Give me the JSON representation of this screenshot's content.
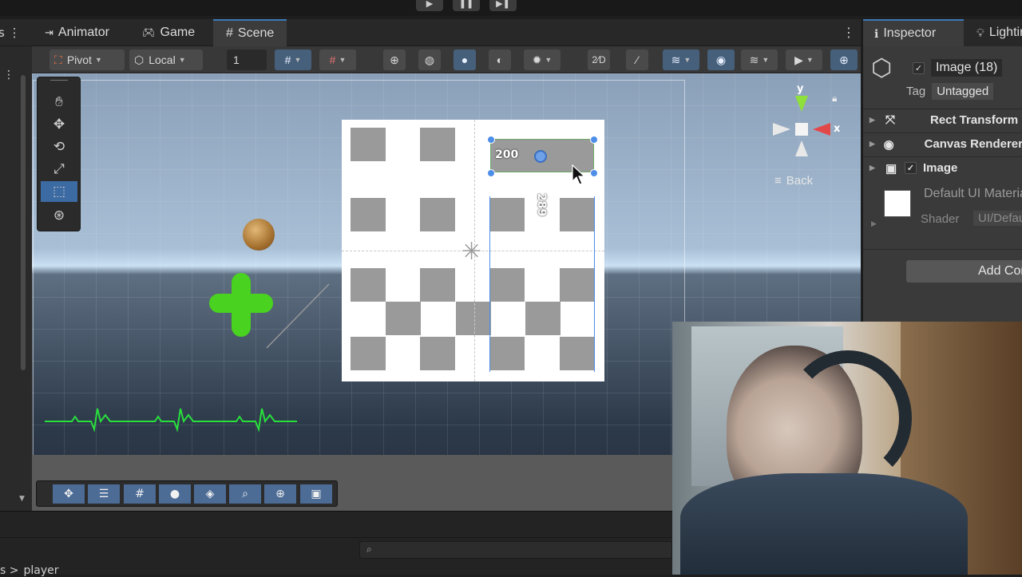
{
  "tabs": [
    {
      "label": "Animator",
      "icon": "animator-icon"
    },
    {
      "label": "Game",
      "icon": "gamepad-icon"
    },
    {
      "label": "Scene",
      "icon": "scene-grid-icon"
    }
  ],
  "toolbar": {
    "pivot_label": "Pivot",
    "space_label": "Local",
    "grid_value": "1"
  },
  "scene": {
    "width_label": "200",
    "height_label": "289",
    "back_label": "Back",
    "axis_y": "y",
    "axis_x": "x"
  },
  "inspector": {
    "tabs": [
      {
        "label": "Inspector",
        "icon": "info-icon"
      },
      {
        "label": "Lighting",
        "icon": "light-icon"
      }
    ],
    "object_name": "Image (18)",
    "tag_label": "Tag",
    "tag_value": "Untagged",
    "components": [
      {
        "label": "Rect Transform",
        "icon": "rect-transform-icon"
      },
      {
        "label": "Canvas Renderer",
        "icon": "eye-icon"
      },
      {
        "label": "Image",
        "icon": "image-icon"
      }
    ],
    "material_label": "Default UI Material",
    "shader_label": "Shader",
    "shader_value": "UI/Default",
    "add_component_label": "Add Component"
  },
  "status": {
    "breadcrumb": "player"
  },
  "colors": {
    "accent": "#3a79bb",
    "selection_handle": "#4d8ee8",
    "heartbeat": "#28e03c"
  }
}
